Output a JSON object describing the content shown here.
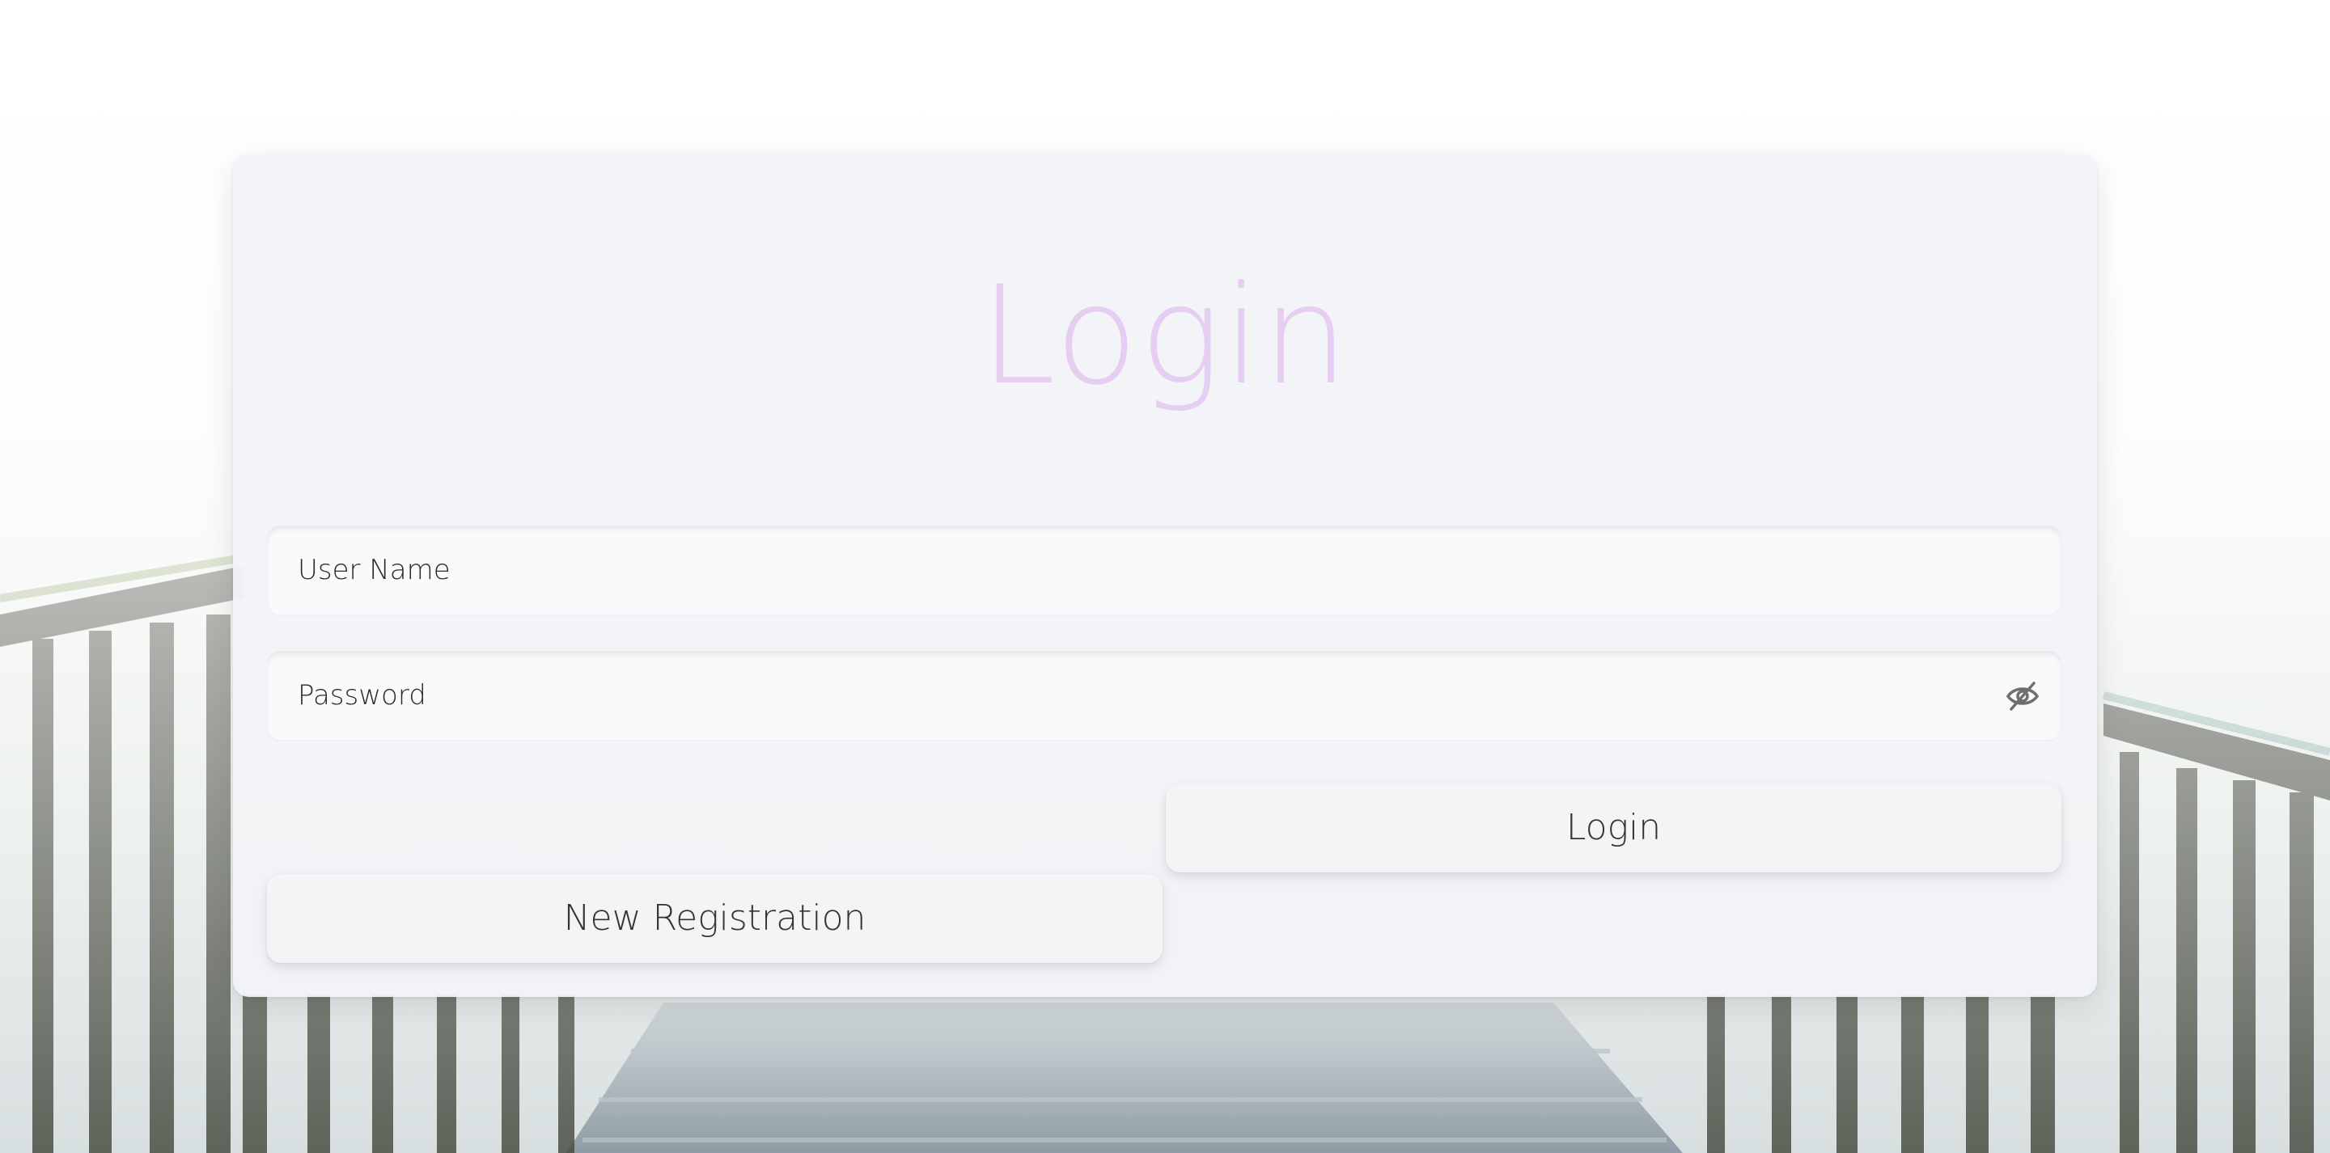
{
  "login_form": {
    "title": "Login",
    "username": {
      "placeholder": "User Name",
      "value": ""
    },
    "password": {
      "placeholder": "Password",
      "value": "",
      "toggle_icon": "eye-slash-icon"
    },
    "login_button_label": "Login",
    "register_button_label": "New Registration"
  },
  "theme": {
    "title_color": "#e6cdf2",
    "card_background": "#f2f3f6",
    "text_color": "#2c2c2c"
  }
}
